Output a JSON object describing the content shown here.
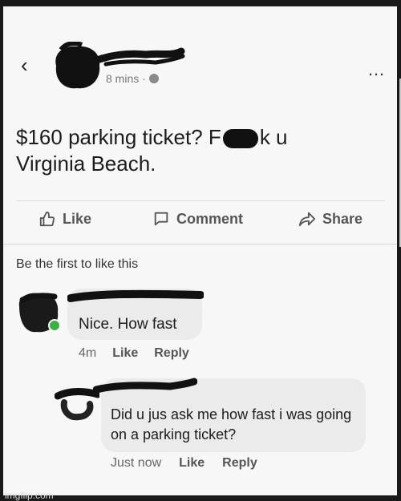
{
  "header": {
    "back_icon": "chevron-left",
    "more_icon": "more-dots",
    "time": "8 mins ·",
    "privacy_icon": "globe-icon"
  },
  "post": {
    "line1_a": "$160 parking ticket? F",
    "line1_b": "k u",
    "line2": "Virginia Beach."
  },
  "actions": {
    "like": "Like",
    "comment": "Comment",
    "share": "Share"
  },
  "likes_summary": "Be the first to like this",
  "comments": [
    {
      "text": "Nice. How fast",
      "time": "4m",
      "like": "Like",
      "reply": "Reply"
    },
    {
      "text": "Did u jus ask me how fast i was going on a parking ticket?",
      "time": "Just now",
      "like": "Like",
      "reply": "Reply"
    }
  ],
  "watermark": "imgflip.com",
  "colors": {
    "background": "#f7f7f7",
    "bubble": "#ebebeb",
    "online": "#3cb043"
  }
}
